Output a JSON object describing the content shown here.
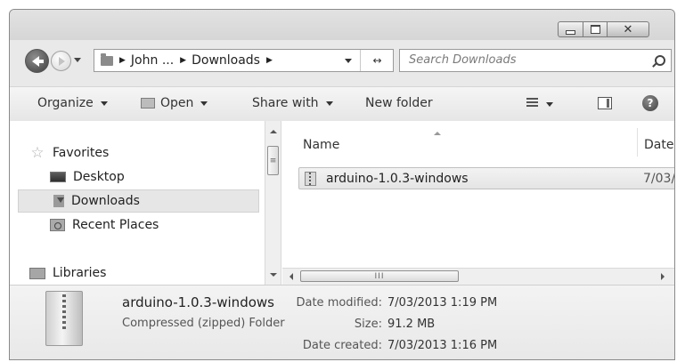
{
  "window": {
    "controls": {
      "minimize": "minimize",
      "maximize": "maximize",
      "close": "✕"
    }
  },
  "navigation": {
    "breadcrumb": [
      "John ...",
      "Downloads"
    ],
    "search_placeholder": "Search Downloads"
  },
  "toolbar": {
    "organize": "Organize",
    "open": "Open",
    "share_with": "Share with",
    "new_folder": "New folder"
  },
  "nav_pane": {
    "items": [
      {
        "label": "Favorites",
        "icon": "star-icon"
      },
      {
        "label": "Desktop",
        "icon": "desktop-icon"
      },
      {
        "label": "Downloads",
        "icon": "downloads-folder-icon",
        "selected": true
      },
      {
        "label": "Recent Places",
        "icon": "recent-places-icon"
      },
      {
        "label": "Libraries",
        "icon": "libraries-icon"
      }
    ]
  },
  "file_list": {
    "columns": {
      "name": "Name",
      "date": "Date"
    },
    "files": [
      {
        "name": "arduino-1.0.3-windows",
        "date": "7/03/",
        "icon": "zip-folder-icon"
      }
    ]
  },
  "details": {
    "name": "arduino-1.0.3-windows",
    "type": "Compressed (zipped) Folder",
    "fields": [
      {
        "label": "Date modified:",
        "value": "7/03/2013 1:19 PM"
      },
      {
        "label": "Size:",
        "value": "91.2 MB"
      },
      {
        "label": "Date created:",
        "value": "7/03/2013 1:16 PM"
      }
    ]
  }
}
